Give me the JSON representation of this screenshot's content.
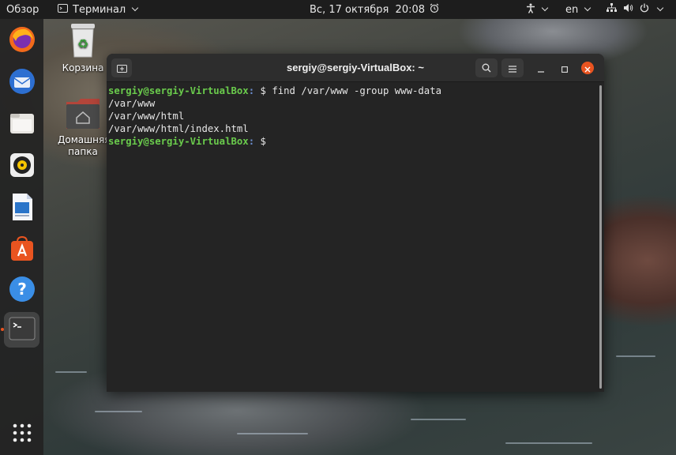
{
  "topbar": {
    "activities": "Обзор",
    "app_menu": "Терминал",
    "datetime": "Вс, 17 октября  20:08",
    "lang": "en"
  },
  "desktop": {
    "trash_label": "Корзина",
    "home_label": "Домашняя папка"
  },
  "dock": {
    "items": [
      "firefox",
      "thunderbird",
      "files",
      "rhythmbox",
      "libreoffice-writer",
      "software",
      "help",
      "terminal",
      "show-apps"
    ]
  },
  "terminal": {
    "title": "sergiy@sergiy-VirtualBox: ~",
    "prompt_user": "sergiy@sergiy-VirtualBox",
    "prompt_path": ":",
    "prompt_tail": " $ ",
    "command": "find /var/www -group www-data",
    "output": [
      "/var/www",
      "/var/www/html",
      "/var/www/html/index.html"
    ]
  },
  "colors": {
    "accent": "#e95420",
    "prompt_user": "#6acb4c",
    "prompt_path": "#6d8fd1"
  }
}
